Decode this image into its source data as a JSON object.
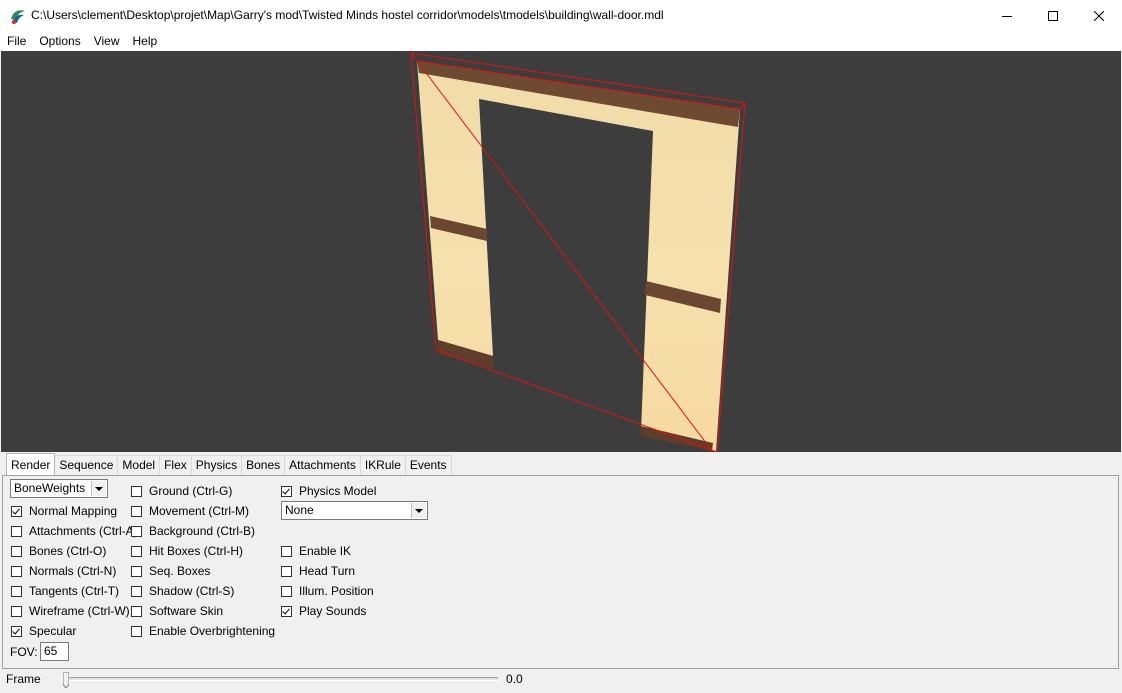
{
  "window": {
    "title": "C:\\Users\\clement\\Desktop\\projet\\Map\\Garry's mod\\Twisted Minds hostel corridor\\models\\tmodels\\building\\wall-door.mdl",
    "icon": "hlmv-app-icon",
    "controls": [
      "minimize-icon",
      "maximize-icon",
      "close-icon"
    ]
  },
  "menu": [
    "File",
    "Options",
    "View",
    "Help"
  ],
  "viewport": {
    "background": "#3d3d3d",
    "wall_color": "#f3d9a4",
    "trim_color": "#6e4a33",
    "bbox_color": "#e01010"
  },
  "tabs": [
    "Render",
    "Sequence",
    "Model",
    "Flex",
    "Physics",
    "Bones",
    "Attachments",
    "IKRule",
    "Events"
  ],
  "render": {
    "render_mode": "BoneWeights",
    "col1": [
      {
        "label": "Normal Mapping",
        "checked": true
      },
      {
        "label": "Attachments (Ctrl-A)",
        "checked": false
      },
      {
        "label": "Bones (Ctrl-O)",
        "checked": false
      },
      {
        "label": "Normals (Ctrl-N)",
        "checked": false
      },
      {
        "label": "Tangents (Ctrl-T)",
        "checked": false
      },
      {
        "label": "Wireframe (Ctrl-W)",
        "checked": false
      },
      {
        "label": "Specular",
        "checked": true
      }
    ],
    "col2": [
      {
        "label": "Ground (Ctrl-G)",
        "checked": false
      },
      {
        "label": "Movement (Ctrl-M)",
        "checked": false
      },
      {
        "label": "Background (Ctrl-B)",
        "checked": false
      },
      {
        "label": "Hit Boxes (Ctrl-H)",
        "checked": false
      },
      {
        "label": "Seq. Boxes",
        "checked": false
      },
      {
        "label": "Shadow (Ctrl-S)",
        "checked": false
      },
      {
        "label": "Software Skin",
        "checked": false
      },
      {
        "label": "Enable Overbrightening",
        "checked": false
      }
    ],
    "physics_model": {
      "label": "Physics Model",
      "checked": true
    },
    "physics_select": "None",
    "col3": [
      {
        "label": "Enable IK",
        "checked": false
      },
      {
        "label": "Head Turn",
        "checked": false
      },
      {
        "label": "Illum. Position",
        "checked": false
      },
      {
        "label": "Play Sounds",
        "checked": true
      }
    ],
    "fov_label": "FOV:",
    "fov_value": "65"
  },
  "frame": {
    "label": "Frame",
    "value": "0.0"
  }
}
